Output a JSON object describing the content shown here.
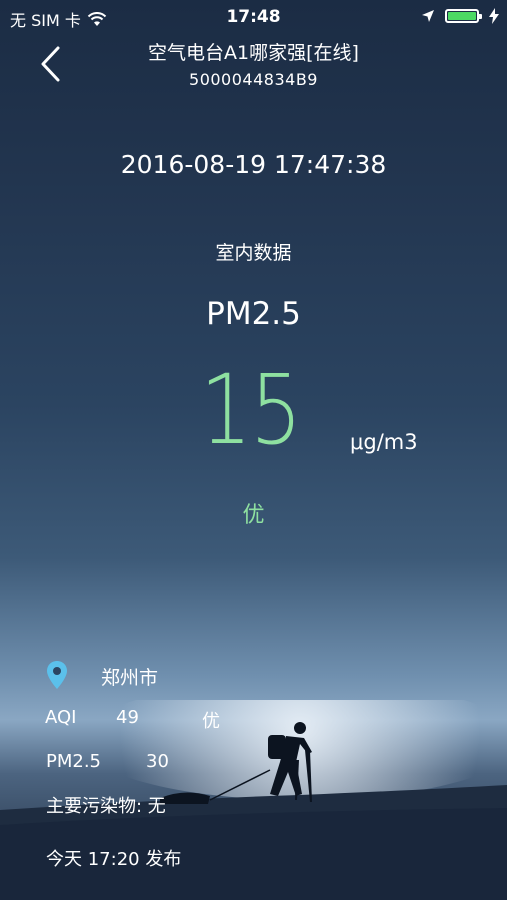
{
  "status_bar": {
    "carrier": "无 SIM 卡",
    "time": "17:48",
    "icons": [
      "wifi-icon",
      "location-arrow-icon",
      "battery-icon",
      "charging-icon"
    ],
    "battery_level": 1.0,
    "battery_color": "#4cd964"
  },
  "nav": {
    "title": "空气电台A1哪家强[在线]",
    "device_id": "5000044834B9"
  },
  "reading": {
    "datetime": "2016-08-19 17:47:38",
    "section": "室内数据",
    "metric": "PM2.5",
    "value": "15",
    "unit": "μg/m3",
    "level": "优",
    "accent_color": "#8ee0a0"
  },
  "outdoor": {
    "city": "郑州市",
    "aqi_label": "AQI",
    "aqi_value": "49",
    "aqi_level": "优",
    "pm_label": "PM2.5",
    "pm_value": "30",
    "pollutant": "主要污染物: 无",
    "publish_time": "今天 17:20 发布",
    "location_icon_color": "#5bc0eb"
  }
}
